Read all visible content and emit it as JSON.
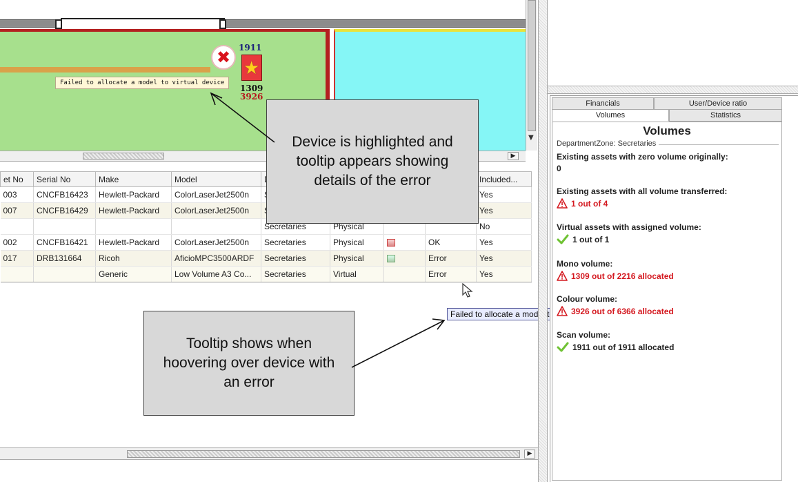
{
  "floorplan": {
    "tooltip": "Failed to allocate a model to virtual device",
    "device_numbers": {
      "top": "1911",
      "mid": "1309",
      "bot": "3926"
    },
    "error_icon": "error-x-icon",
    "device_icon": "star-device-icon"
  },
  "table": {
    "columns": [
      "et No",
      "Serial No",
      "Make",
      "Model",
      "D",
      "",
      "",
      "",
      "Included..."
    ],
    "rows": [
      {
        "asset": "003",
        "serial": "CNCFB16423",
        "make": "Hewlett-Packard",
        "model": "ColorLaserJet2500n",
        "dept": "Se",
        "type": "",
        "icon": "",
        "status": "",
        "included": "Yes"
      },
      {
        "asset": "007",
        "serial": "CNCFB16429",
        "make": "Hewlett-Packard",
        "model": "ColorLaserJet2500n",
        "dept": "Se",
        "type": "",
        "icon": "",
        "status": "",
        "included": "Yes"
      },
      {
        "asset": "",
        "serial": "",
        "make": "",
        "model": "",
        "dept": "Secretaries",
        "type": "Physical",
        "icon": "",
        "status": "",
        "included": "No"
      },
      {
        "asset": "002",
        "serial": "CNCFB16421",
        "make": "Hewlett-Packard",
        "model": "ColorLaserJet2500n",
        "dept": "Secretaries",
        "type": "Physical",
        "icon": "red-device-icon",
        "status": "OK",
        "included": "Yes"
      },
      {
        "asset": "017",
        "serial": "DRB131664",
        "make": "Ricoh",
        "model": "AficioMPC3500ARDF",
        "dept": "Secretaries",
        "type": "Physical",
        "icon": "green-device-icon",
        "status": "Error",
        "included": "Yes"
      },
      {
        "asset": "",
        "serial": "",
        "make": "Generic",
        "model": "Low Volume A3 Co...",
        "dept": "Secretaries",
        "type": "Virtual",
        "icon": "",
        "status": "Error",
        "included": "Yes"
      }
    ],
    "tooltip": "Failed to allocate a model to virtual device"
  },
  "right_panel": {
    "tabs": [
      "Financials",
      "User/Device ratio",
      "Volumes",
      "Statistics"
    ],
    "active_tab": "Volumes",
    "title": "Volumes",
    "zone_legend": "DepartmentZone: Secretaries",
    "stats": [
      {
        "label": "Existing assets with zero volume originally:",
        "value": "0",
        "status": "none"
      },
      {
        "label": "Existing assets with all volume transferred:",
        "value": "1 out of 4",
        "status": "warning"
      },
      {
        "label": "Virtual assets with assigned volume:",
        "value": "1 out of 1",
        "status": "ok"
      },
      {
        "label": "Mono volume:",
        "value": "1309 out of 2216 allocated",
        "status": "warning"
      },
      {
        "label": "Colour volume:",
        "value": "3926 out of 6366 allocated",
        "status": "warning"
      },
      {
        "label": "Scan volume:",
        "value": "1911 out of 1911 allocated",
        "status": "ok"
      }
    ]
  },
  "callouts": {
    "one": "Device is highlighted and tooltip appears showing details of the error",
    "two": "Tooltip shows when hoovering over device with an error"
  },
  "colors": {
    "error_red": "#d4181f",
    "ok_green": "#6fc233",
    "room_green": "#a7e08d",
    "room_cyan": "#85f6f6",
    "callout_gray": "#d8d8d8"
  }
}
